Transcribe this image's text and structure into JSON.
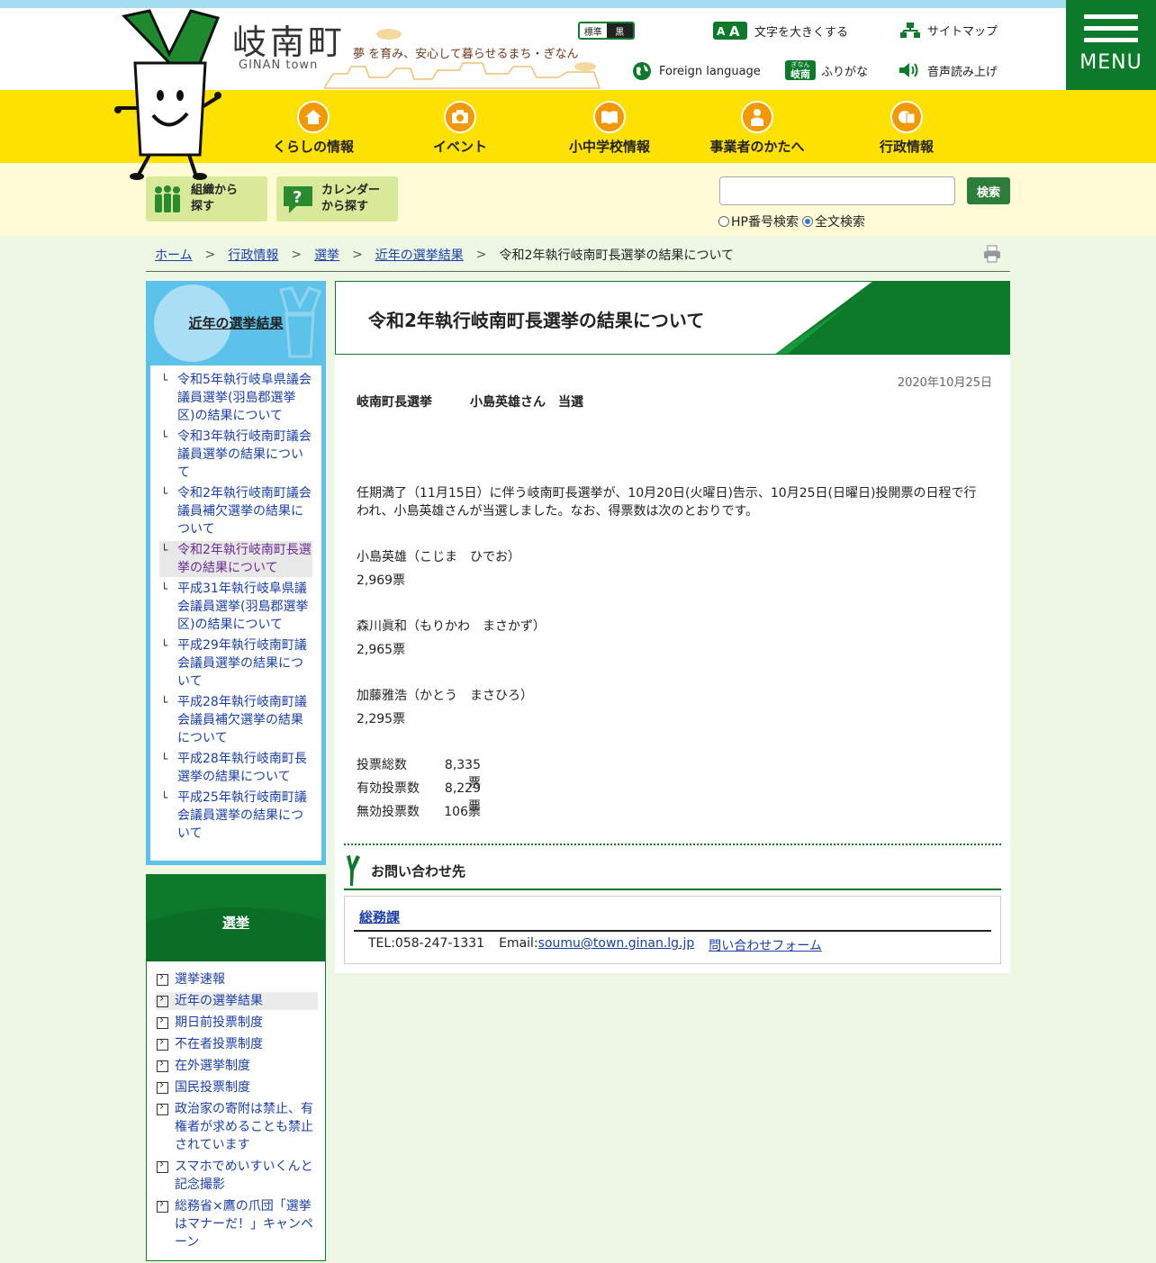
{
  "header": {
    "site_name": "岐南町",
    "site_name_en": "GINAN town",
    "tagline": "夢 を育み、安心して暮らせるまち・ぎなん",
    "contrast": {
      "standard": "標準",
      "black": "黒"
    },
    "utility": {
      "text_size": "文字を大きくする",
      "sitemap": "サイトマップ",
      "foreign": "Foreign language",
      "furigana": "ふりがな",
      "furigana_badge_top": "ぎなん",
      "furigana_badge": "岐南",
      "read_aloud": "音声読み上げ"
    },
    "menu_label": "MENU"
  },
  "global_nav": [
    {
      "label": "くらしの情報"
    },
    {
      "label": "イベント"
    },
    {
      "label": "小中学校情報"
    },
    {
      "label": "事業者のかたへ"
    },
    {
      "label": "行政情報"
    }
  ],
  "search_bar": {
    "by_org": "組織から\n探す",
    "by_calendar": "カレンダー\nから探す",
    "query": "",
    "button": "検索",
    "options": [
      {
        "label": "HP番号検索",
        "selected": false
      },
      {
        "label": "全文検索",
        "selected": true
      }
    ]
  },
  "breadcrumb": [
    "ホーム",
    "行政情報",
    "選挙",
    "近年の選挙結果",
    "令和2年執行岐南町長選挙の結果について"
  ],
  "left_nav": {
    "title": "近年の選挙結果",
    "items": [
      {
        "label": "令和5年執行岐阜県議会議員選挙(羽島郡選挙区)の結果について",
        "current": false
      },
      {
        "label": "令和3年執行岐南町議会議員選挙の結果について",
        "current": false
      },
      {
        "label": "令和2年執行岐南町議会議員補欠選挙の結果について",
        "current": false
      },
      {
        "label": "令和2年執行岐南町長選挙の結果について",
        "current": true
      },
      {
        "label": "平成31年執行岐阜県議会議員選挙(羽島郡選挙区)の結果について",
        "current": false
      },
      {
        "label": "平成29年執行岐南町議会議員選挙の結果について",
        "current": false
      },
      {
        "label": "平成28年執行岐南町議会議員補欠選挙の結果について",
        "current": false
      },
      {
        "label": "平成28年執行岐南町長選挙の結果について",
        "current": false
      },
      {
        "label": "平成25年執行岐南町議会議員選挙の結果について",
        "current": false
      }
    ]
  },
  "section_nav": {
    "title": "選挙",
    "items": [
      {
        "label": "選挙速報",
        "current": false
      },
      {
        "label": "近年の選挙結果",
        "current": true
      },
      {
        "label": "期日前投票制度",
        "current": false
      },
      {
        "label": "不在者投票制度",
        "current": false
      },
      {
        "label": "在外選挙制度",
        "current": false
      },
      {
        "label": "国民投票制度",
        "current": false
      },
      {
        "label": "政治家の寄附は禁止、有権者が求めることも禁止されています",
        "current": false
      },
      {
        "label": "スマホでめいすいくんと記念撮影",
        "current": false
      },
      {
        "label": "総務省×鷹の爪団「選挙はマナーだ！」キャンペーン",
        "current": false
      }
    ]
  },
  "article": {
    "title": "令和2年執行岐南町長選挙の結果について",
    "date": "2020年10月25日",
    "lead_election": "岐南町長選挙",
    "lead_result": "小島英雄さん　当選",
    "intro": "任期満了（11月15日）に伴う岐南町長選挙が、10月20日(火曜日)告示、10月25日(日曜日)投開票の日程で行われ、小島英雄さんが当選しました。なお、得票数は次のとおりです。",
    "candidates": [
      {
        "name": "小島英雄（こじま　ひでお）",
        "votes": "2,969票"
      },
      {
        "name": "森川眞和（もりかわ　まさかず）",
        "votes": "2,965票"
      },
      {
        "name": "加藤雅浩（かとう　まさひろ）",
        "votes": "2,295票"
      }
    ],
    "totals": [
      {
        "label": "投票総数",
        "value": "8,335票"
      },
      {
        "label": "有効投票数",
        "value": "8,229票"
      },
      {
        "label": "無効投票数",
        "value": "106票"
      }
    ]
  },
  "contact": {
    "heading": "お問い合わせ先",
    "department": "総務課",
    "tel": "TEL:058-247-1331",
    "email_label": "Email:",
    "email": "soumu@town.ginan.lg.jp",
    "form_link": "問い合わせフォーム"
  },
  "colors": {
    "green": "#0c7a2a",
    "yellow": "#ffe100",
    "sky": "#5dc2ea",
    "link": "#1a3fa8"
  }
}
